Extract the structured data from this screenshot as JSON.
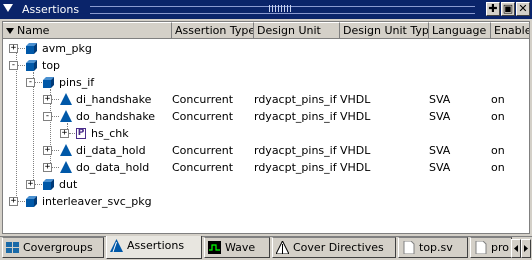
{
  "window": {
    "title": "Assertions"
  },
  "columns": [
    "Name",
    "Assertion Type",
    "Design Unit",
    "Design Unit Type",
    "Language",
    "Enable"
  ],
  "rows": [
    {
      "name": "avm_pkg",
      "icon": "package-icon",
      "expander": "+",
      "type": "",
      "unit": "",
      "unittype": "",
      "lang": "",
      "enable": ""
    },
    {
      "name": "top",
      "icon": "package-icon",
      "expander": "-",
      "type": "",
      "unit": "",
      "unittype": "",
      "lang": "",
      "enable": ""
    },
    {
      "name": "pins_if",
      "icon": "package-icon",
      "expander": "-",
      "type": "",
      "unit": "",
      "unittype": "",
      "lang": "",
      "enable": ""
    },
    {
      "name": "di_handshake",
      "icon": "assertion-icon",
      "expander": "+",
      "type": "Concurrent",
      "unit": "rdyacpt_pins_if",
      "unittype": "VHDL",
      "lang": "SVA",
      "enable": "on"
    },
    {
      "name": "do_handshake",
      "icon": "assertion-icon",
      "expander": "-",
      "type": "Concurrent",
      "unit": "rdyacpt_pins_if",
      "unittype": "VHDL",
      "lang": "SVA",
      "enable": "on"
    },
    {
      "name": "hs_chk",
      "icon": "property-icon",
      "icon_letter": "P",
      "expander": "+",
      "type": "",
      "unit": "",
      "unittype": "",
      "lang": "",
      "enable": ""
    },
    {
      "name": "di_data_hold",
      "icon": "assertion-icon",
      "expander": "+",
      "type": "Concurrent",
      "unit": "rdyacpt_pins_if",
      "unittype": "VHDL",
      "lang": "SVA",
      "enable": "on"
    },
    {
      "name": "do_data_hold",
      "icon": "assertion-icon",
      "expander": "+",
      "type": "Concurrent",
      "unit": "rdyacpt_pins_if",
      "unittype": "VHDL",
      "lang": "SVA",
      "enable": "on"
    },
    {
      "name": "dut",
      "icon": "package-icon",
      "expander": "+",
      "type": "",
      "unit": "",
      "unittype": "",
      "lang": "",
      "enable": ""
    },
    {
      "name": "interleaver_svc_pkg",
      "icon": "package-icon",
      "expander": "+",
      "type": "",
      "unit": "",
      "unittype": "",
      "lang": "",
      "enable": ""
    }
  ],
  "tabs": [
    {
      "label": "Covergroups",
      "icon": "covergroups-icon"
    },
    {
      "label": "Assertions",
      "icon": "assertions-icon",
      "active": true
    },
    {
      "label": "Wave",
      "icon": "wave-icon"
    },
    {
      "label": "Cover Directives",
      "icon": "cover-directives-icon"
    },
    {
      "label": "top.sv",
      "icon": "file-icon"
    },
    {
      "label": "pro",
      "icon": "file-icon"
    }
  ],
  "colors": {
    "titlebar": "#0a246a",
    "chrome": "#d4d0c8",
    "tree_icon": "#0058a8",
    "active_tab": "#e8e6e0"
  }
}
